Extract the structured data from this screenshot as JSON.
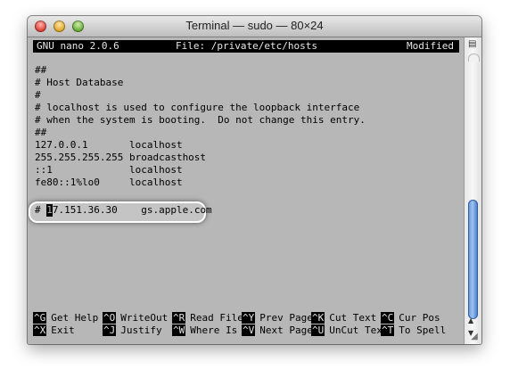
{
  "window": {
    "title": "Terminal — sudo — 80×24"
  },
  "nano": {
    "version": "GNU nano 2.0.6",
    "file": "File: /private/etc/hosts",
    "status": "Modified"
  },
  "file_lines": [
    "##",
    "# Host Database",
    "#",
    "# localhost is used to configure the loopback interface",
    "# when the system is booting.  Do not change this entry.",
    "##",
    "127.0.0.1       localhost",
    "255.255.255.255 broadcasthost",
    "::1             localhost",
    "fe80::1%lo0     localhost"
  ],
  "edited_line": {
    "prefix": "# ",
    "first_char": "1",
    "rest": "7.151.36.30    gs.apple.com"
  },
  "shortcuts_row1": [
    {
      "key": "^G",
      "label": "Get Help"
    },
    {
      "key": "^O",
      "label": "WriteOut"
    },
    {
      "key": "^R",
      "label": "Read File"
    },
    {
      "key": "^Y",
      "label": "Prev Page"
    },
    {
      "key": "^K",
      "label": "Cut Text"
    },
    {
      "key": "^C",
      "label": "Cur Pos"
    }
  ],
  "shortcuts_row2": [
    {
      "key": "^X",
      "label": "Exit"
    },
    {
      "key": "^J",
      "label": "Justify"
    },
    {
      "key": "^W",
      "label": "Where Is"
    },
    {
      "key": "^V",
      "label": "Next Page"
    },
    {
      "key": "^U",
      "label": "UnCut Text"
    },
    {
      "key": "^T",
      "label": "To Spell"
    }
  ],
  "icons": {
    "scroll_menu": "scroll-menu-icon",
    "scroll_up": "arrow-up-icon",
    "scroll_down": "arrow-down-icon",
    "resize": "resize-grip-icon"
  },
  "colors": {
    "screen_bg": "#b7b7b7",
    "scroll_thumb": "#5f8fd3"
  }
}
